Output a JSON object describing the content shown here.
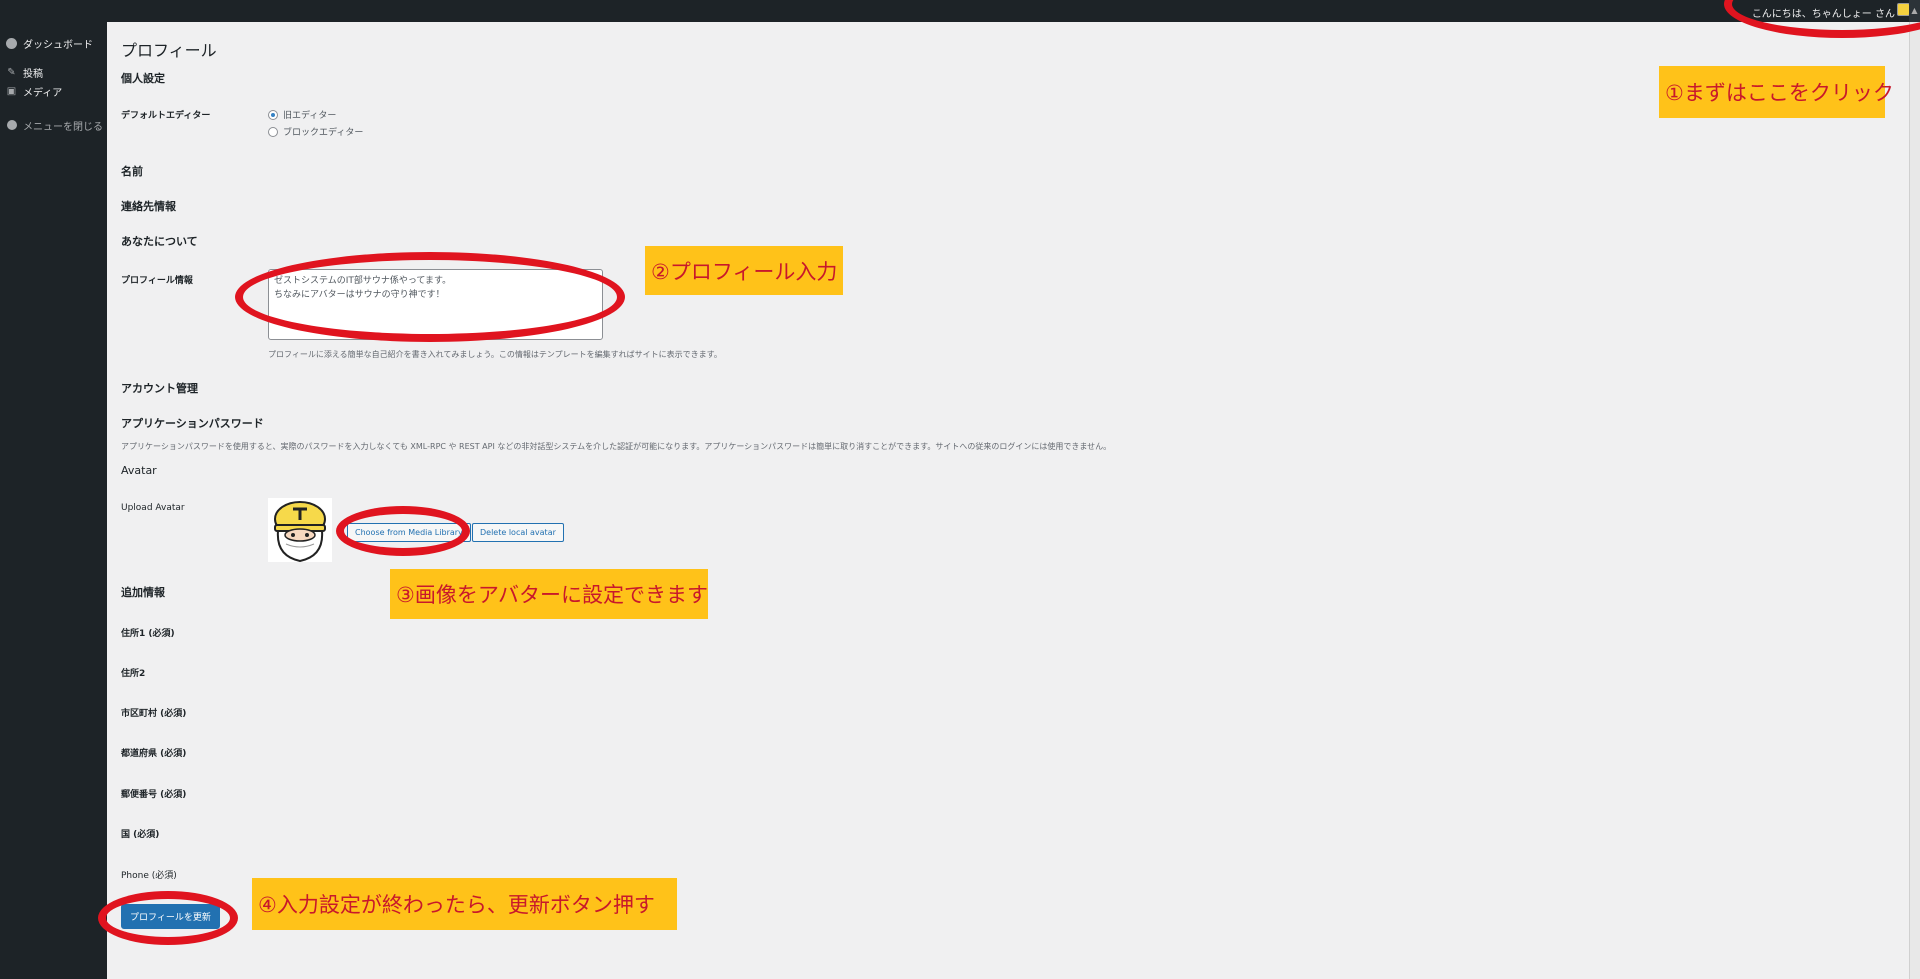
{
  "adminbar": {
    "greeting": "こんにちは、ちゃんしょー さん"
  },
  "sidebar": {
    "items": [
      {
        "label": "ダッシュボード"
      },
      {
        "label": "投稿"
      },
      {
        "label": "メディア"
      }
    ],
    "collapse_label": "メニューを閉じる"
  },
  "page": {
    "title": "プロフィール",
    "personal_settings": "個人設定",
    "default_editor_label": "デフォルトエディター",
    "editor_options": [
      "旧エディター",
      "ブロックエディター"
    ],
    "editor_selected": "旧エディター",
    "name_heading": "名前",
    "contact_heading": "連絡先情報",
    "about_heading": "あなたについて",
    "bio_label": "プロフィール情報",
    "bio_lines": [
      "ゼストシステムのIT部サウナ係やってます。",
      "ちなみにアバターはサウナの守り神です！"
    ],
    "bio_desc": "プロフィールに添える簡単な自己紹介を書き入れてみましょう。この情報はテンプレートを編集すればサイトに表示できます。",
    "account_heading": "アカウント管理",
    "app_password_heading": "アプリケーションパスワード",
    "app_password_desc": "アプリケーションパスワードを使用すると、実際のパスワードを入力しなくても XML-RPC や REST API などの非対話型システムを介した認証が可能になります。アプリケーションパスワードは簡単に取り消すことができます。サイトへの従来のログインには使用できません。",
    "avatar_heading": "Avatar",
    "upload_avatar_label": "Upload Avatar",
    "choose_media_button": "Choose from Media Library",
    "delete_avatar_button": "Delete local avatar",
    "additional_heading": "追加情報",
    "fields": [
      "住所1 (必須)",
      "住所2",
      "市区町村 (必須)",
      "都道府県 (必須)",
      "郵便番号 (必須)",
      "国 (必須)",
      "Phone (必須)"
    ],
    "submit_button": "プロフィールを更新"
  },
  "annotations": {
    "note1": "①まずはここをクリック",
    "note2": "②プロフィール入力",
    "note3": "③画像をアバターに設定できます",
    "note4": "④入力設定が終わったら、更新ボタン押す",
    "accent_color": "#e0141f",
    "note_bg": "#ffc219"
  }
}
